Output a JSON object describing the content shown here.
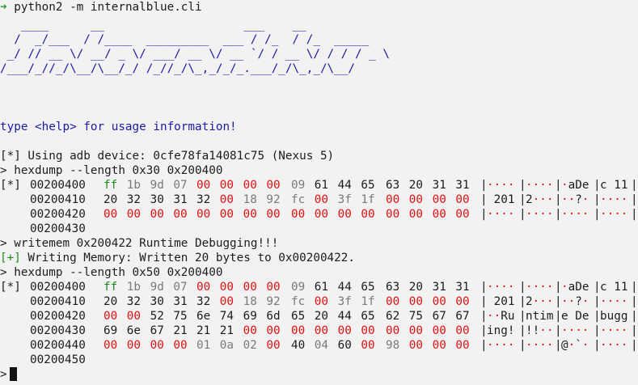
{
  "command_line": {
    "prompt_symbol": "➜",
    "command": "python2 -m internalblue.cli"
  },
  "logo_lines": [
    "   ____      __                    ___    __",
    "  /  _/___  / /____  _________  ___ / /_  / /_  _____",
    " _/ // __ \\/ __/ _ \\/ ___/ __ \\/ __ `/ / __ \\/ / / / _ \\",
    "/___/_//_/\\__/\\__/_/ /_//_/\\_,_/_/_.___/_/\\_,_/\\__/"
  ],
  "help_line": "type <help> for usage information!",
  "messages": {
    "adb": "[*] Using adb device: 0cfe78fa14081c75 (Nexus 5)",
    "cmd1": "> hexdump --length 0x30 0x200400",
    "cmd2": "> writemem 0x200422 Runtime Debugging!!!",
    "write_prefix": "[+]",
    "write_msg": " Writing Memory: Written 20 bytes to 0x00200422.",
    "cmd3": "> hexdump --length 0x50 0x200400",
    "star": "[*]",
    "final_prompt": ">"
  },
  "hexdump1": [
    {
      "addr": "00200400",
      "bytes": [
        "ff",
        "1b",
        "9d",
        "07",
        "00",
        "00",
        "00",
        "00",
        "09",
        "61",
        "44",
        "65",
        "63",
        "20",
        "31",
        "31"
      ],
      "ascii": [
        "····",
        "····",
        "·aDe",
        "c 11"
      ]
    },
    {
      "addr": "00200410",
      "bytes": [
        "20",
        "32",
        "30",
        "31",
        "32",
        "00",
        "18",
        "92",
        "fc",
        "00",
        "3f",
        "1f",
        "00",
        "00",
        "00",
        "00"
      ],
      "ascii": [
        " 201",
        "2···",
        "··?·",
        "····"
      ]
    },
    {
      "addr": "00200420",
      "bytes": [
        "00",
        "00",
        "00",
        "00",
        "00",
        "00",
        "00",
        "00",
        "00",
        "00",
        "00",
        "00",
        "00",
        "00",
        "00",
        "00"
      ],
      "ascii": [
        "····",
        "····",
        "····",
        "····"
      ]
    },
    {
      "addr": "00200430",
      "bytes": [],
      "ascii": []
    }
  ],
  "hexdump2": [
    {
      "addr": "00200400",
      "bytes": [
        "ff",
        "1b",
        "9d",
        "07",
        "00",
        "00",
        "00",
        "00",
        "09",
        "61",
        "44",
        "65",
        "63",
        "20",
        "31",
        "31"
      ],
      "ascii": [
        "····",
        "····",
        "·aDe",
        "c 11"
      ]
    },
    {
      "addr": "00200410",
      "bytes": [
        "20",
        "32",
        "30",
        "31",
        "32",
        "00",
        "18",
        "92",
        "fc",
        "00",
        "3f",
        "1f",
        "00",
        "00",
        "00",
        "00"
      ],
      "ascii": [
        " 201",
        "2···",
        "··?·",
        "····"
      ]
    },
    {
      "addr": "00200420",
      "bytes": [
        "00",
        "00",
        "52",
        "75",
        "6e",
        "74",
        "69",
        "6d",
        "65",
        "20",
        "44",
        "65",
        "62",
        "75",
        "67",
        "67"
      ],
      "ascii": [
        "··Ru",
        "ntim",
        "e De",
        "bugg"
      ]
    },
    {
      "addr": "00200430",
      "bytes": [
        "69",
        "6e",
        "67",
        "21",
        "21",
        "21",
        "00",
        "00",
        "00",
        "00",
        "00",
        "00",
        "00",
        "00",
        "00",
        "00"
      ],
      "ascii": [
        "ing!",
        "!!··",
        "····",
        "····"
      ]
    },
    {
      "addr": "00200440",
      "bytes": [
        "00",
        "00",
        "00",
        "00",
        "01",
        "0a",
        "02",
        "00",
        "40",
        "04",
        "60",
        "00",
        "98",
        "00",
        "00",
        "00"
      ],
      "ascii": [
        "····",
        "····",
        "@·`·",
        "····"
      ]
    },
    {
      "addr": "00200450",
      "bytes": [],
      "ascii": []
    }
  ]
}
